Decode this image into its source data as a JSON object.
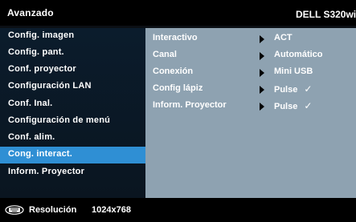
{
  "header": {
    "title": "Avanzado",
    "model": "DELL S320wi"
  },
  "sidebar": {
    "items": [
      {
        "label": "Config. imagen",
        "active": false
      },
      {
        "label": "Config. pant.",
        "active": false
      },
      {
        "label": "Conf. proyector",
        "active": false
      },
      {
        "label": "Configuración LAN",
        "active": false
      },
      {
        "label": "Conf. Inal.",
        "active": false
      },
      {
        "label": "Configuración de menú",
        "active": false
      },
      {
        "label": "Conf. alim.",
        "active": false
      },
      {
        "label": "Cong. interact.",
        "active": true
      },
      {
        "label": "Inform. Proyector",
        "active": false
      }
    ]
  },
  "content": {
    "rows": [
      {
        "label": "Interactivo",
        "value": "ACT",
        "check": ""
      },
      {
        "label": "Canal",
        "value": "Automático",
        "check": ""
      },
      {
        "label": "Conexión",
        "value": "Mini USB",
        "check": ""
      },
      {
        "label": "Config lápiz",
        "value": "Pulse",
        "check": "✓"
      },
      {
        "label": "Inform. Proyector",
        "value": "Pulse",
        "check": "✓"
      }
    ]
  },
  "footer": {
    "icon": "keyboard-icon",
    "label": "Resolución",
    "value": "1024x768"
  },
  "colors": {
    "highlight": "#2f8fd4",
    "content_bg": "#8ea2b1",
    "sidebar_bg": "#0b1c2c"
  }
}
